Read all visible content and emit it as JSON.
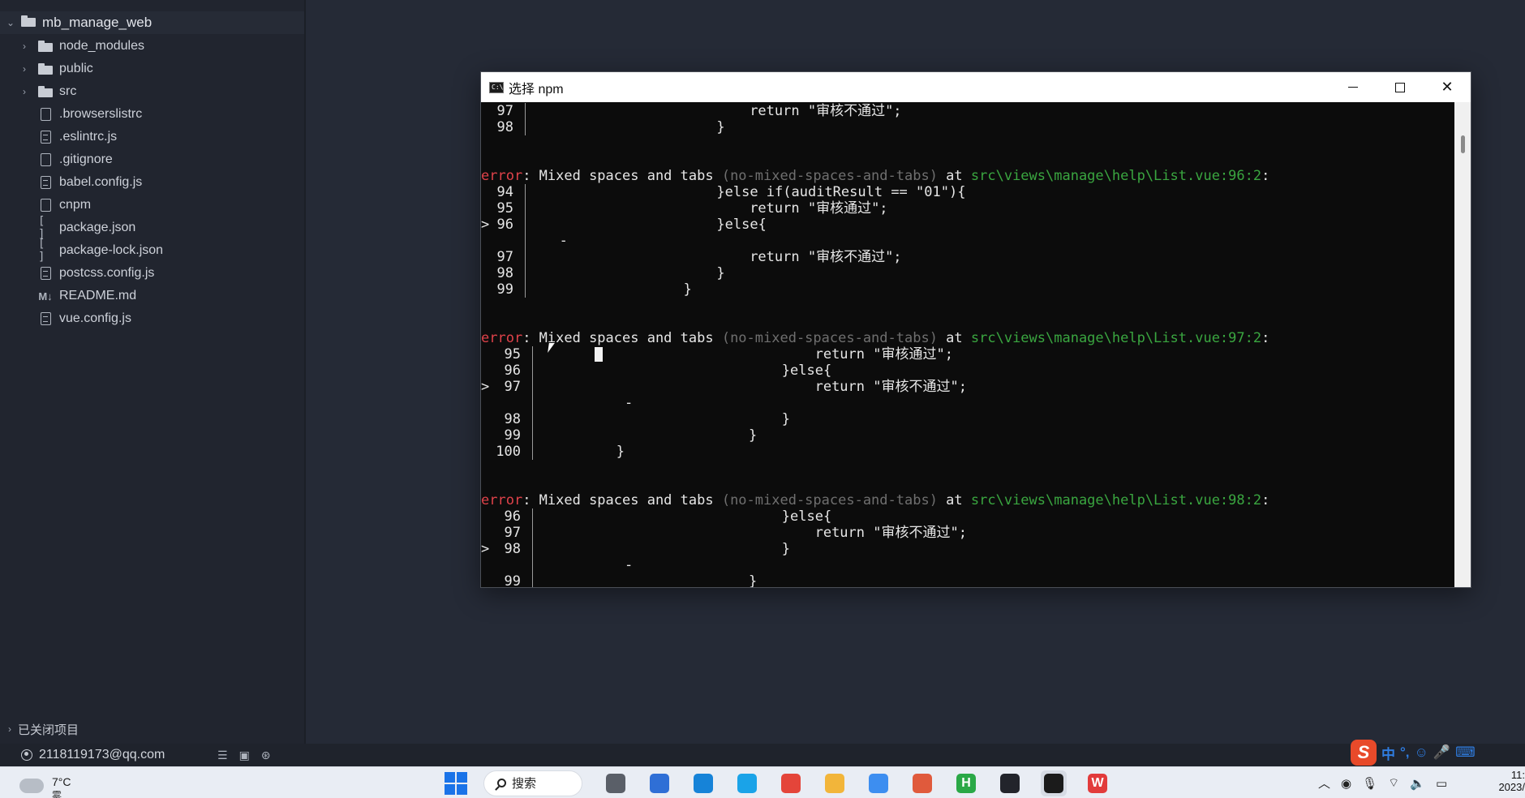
{
  "sidebar": {
    "root": {
      "label": "mb_manage_web",
      "icon": "folder-open-icon"
    },
    "items": [
      {
        "label": "node_modules",
        "type": "folder",
        "icon": "folder-icon",
        "expandable": true
      },
      {
        "label": "public",
        "type": "folder",
        "icon": "folder-icon",
        "expandable": true
      },
      {
        "label": "src",
        "type": "folder",
        "icon": "folder-icon",
        "expandable": true
      },
      {
        "label": ".browserslistrc",
        "type": "file",
        "icon": "file-icon"
      },
      {
        "label": ".eslintrc.js",
        "type": "file",
        "icon": "file-code-icon"
      },
      {
        "label": ".gitignore",
        "type": "file",
        "icon": "file-icon"
      },
      {
        "label": "babel.config.js",
        "type": "file",
        "icon": "file-code-icon"
      },
      {
        "label": "cnpm",
        "type": "file",
        "icon": "file-icon"
      },
      {
        "label": "package.json",
        "type": "json",
        "icon": "json-brackets-icon"
      },
      {
        "label": "package-lock.json",
        "type": "json",
        "icon": "json-brackets-icon"
      },
      {
        "label": "postcss.config.js",
        "type": "file",
        "icon": "file-code-icon"
      },
      {
        "label": "README.md",
        "type": "md",
        "icon": "markdown-icon"
      },
      {
        "label": "vue.config.js",
        "type": "file",
        "icon": "file-code-icon"
      }
    ],
    "closed_projects": "已关闭项目"
  },
  "statusbar": {
    "account": "2118119173@qq.com",
    "icons": [
      "list-icon",
      "terminal-icon",
      "network-icon"
    ]
  },
  "terminal": {
    "title": "选择 npm",
    "lines": [
      {
        "type": "code",
        "num": "97",
        "code": "return \"审核不通过\";",
        "indent": 26,
        "bar": "a"
      },
      {
        "type": "code",
        "num": "98",
        "code": "}",
        "indent": 22,
        "bar": "a"
      },
      {
        "type": "blank"
      },
      {
        "type": "blank"
      },
      {
        "type": "error",
        "err": "error",
        "msg": ": Mixed spaces and tabs ",
        "rule": "(no-mixed-spaces-and-tabs)",
        "at": " at ",
        "loc": "src\\views\\manage\\help\\List.vue:96:2",
        "end": ":"
      },
      {
        "type": "code",
        "num": "94",
        "code": "}else if(auditResult == \"01\"){",
        "indent": 22,
        "bar": "a"
      },
      {
        "type": "code",
        "num": "95",
        "code": "return \"审核通过\";",
        "indent": 26,
        "bar": "a"
      },
      {
        "type": "code",
        "num": "96",
        "code": "}else{",
        "indent": 22,
        "bar": "a",
        "marker": ">"
      },
      {
        "type": "caret",
        "text": "-",
        "indent": 3,
        "bar": "a"
      },
      {
        "type": "code",
        "num": "97",
        "code": "return \"审核不通过\";",
        "indent": 26,
        "bar": "a"
      },
      {
        "type": "code",
        "num": "98",
        "code": "}",
        "indent": 22,
        "bar": "a"
      },
      {
        "type": "code",
        "num": "99",
        "code": "}",
        "indent": 18,
        "bar": "a"
      },
      {
        "type": "blank"
      },
      {
        "type": "blank"
      },
      {
        "type": "error",
        "err": "error",
        "msg": ": Mixed spaces and tabs ",
        "rule": "(no-mixed-spaces-and-tabs)",
        "at": " at ",
        "loc": "src\\views\\manage\\help\\List.vue:97:2",
        "end": ":"
      },
      {
        "type": "code",
        "num": "95",
        "code": "return \"审核通过\";",
        "indent": 33,
        "bar": "b"
      },
      {
        "type": "code",
        "num": "96",
        "code": "}else{",
        "indent": 29,
        "bar": "b"
      },
      {
        "type": "code",
        "num": "97",
        "code": "return \"审核不通过\";",
        "indent": 33,
        "bar": "b",
        "marker": ">"
      },
      {
        "type": "caret",
        "text": "-",
        "indent": 10,
        "bar": "b"
      },
      {
        "type": "code",
        "num": "98",
        "code": "}",
        "indent": 29,
        "bar": "b"
      },
      {
        "type": "code",
        "num": "99",
        "code": "}",
        "indent": 25,
        "bar": "b"
      },
      {
        "type": "code",
        "num": "100",
        "code": "}",
        "indent": 9,
        "bar": "b"
      },
      {
        "type": "blank"
      },
      {
        "type": "blank"
      },
      {
        "type": "error",
        "err": "error",
        "msg": ": Mixed spaces and tabs ",
        "rule": "(no-mixed-spaces-and-tabs)",
        "at": " at ",
        "loc": "src\\views\\manage\\help\\List.vue:98:2",
        "end": ":"
      },
      {
        "type": "code",
        "num": "96",
        "code": "}else{",
        "indent": 29,
        "bar": "b"
      },
      {
        "type": "code",
        "num": "97",
        "code": "return \"审核不通过\";",
        "indent": 33,
        "bar": "b"
      },
      {
        "type": "code",
        "num": "98",
        "code": "}",
        "indent": 29,
        "bar": "b",
        "marker": ">"
      },
      {
        "type": "caret",
        "text": "-",
        "indent": 10,
        "bar": "b"
      },
      {
        "type": "code",
        "num": "99",
        "code": "}",
        "indent": 25,
        "bar": "b"
      }
    ]
  },
  "taskbar": {
    "weather_temp": "7°C",
    "weather_desc": "雾",
    "search_label": "搜索",
    "apps": [
      {
        "name": "file-explorer-app",
        "label": "",
        "color": "#5a5f68"
      },
      {
        "name": "pc-manager-app",
        "label": "",
        "color": "#2f6fd6"
      },
      {
        "name": "edge-app",
        "label": "",
        "color": "#1683d8"
      },
      {
        "name": "sogou-browser-app",
        "label": "",
        "color": "#1aa3e8"
      },
      {
        "name": "chrome-app",
        "label": "",
        "color": "#e4453a"
      },
      {
        "name": "folder-app",
        "label": "",
        "color": "#f2b53a"
      },
      {
        "name": "dingtalk-app",
        "label": "",
        "color": "#3d8ef0"
      },
      {
        "name": "office-app",
        "label": "",
        "color": "#e05a3c"
      },
      {
        "name": "hbuilder-app",
        "label": "H",
        "color": "#2aa846"
      },
      {
        "name": "jetbrains-app",
        "label": "",
        "color": "#22242b"
      },
      {
        "name": "terminal-app",
        "label": "",
        "color": "#1b1b1b"
      },
      {
        "name": "wps-app",
        "label": "W",
        "color": "#e23b3b"
      }
    ],
    "clock_time": "11:",
    "clock_date": "2023/"
  },
  "ime": {
    "items": [
      "中",
      "°,",
      "☺",
      "🎤",
      "⌨"
    ]
  }
}
